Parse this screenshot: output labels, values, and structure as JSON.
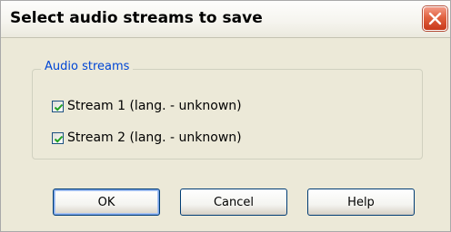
{
  "window": {
    "title": "Select audio streams to save",
    "close_icon": "close-icon",
    "close_color": "#d9532f"
  },
  "group": {
    "label": "Audio streams",
    "label_color": "#0046d5"
  },
  "streams": [
    {
      "label": "Stream 1 (lang. - unknown)",
      "checked": true
    },
    {
      "label": "Stream 2 (lang. - unknown)",
      "checked": true
    }
  ],
  "buttons": {
    "ok": "OK",
    "cancel": "Cancel",
    "help": "Help"
  },
  "check_color": "#21a121"
}
